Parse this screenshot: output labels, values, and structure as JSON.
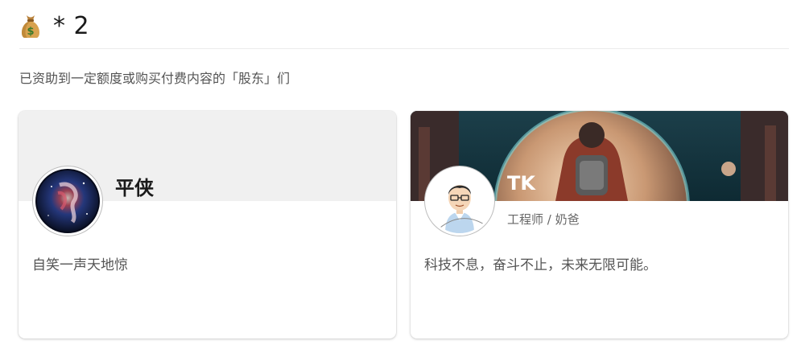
{
  "header": {
    "icon": "money-bag-icon",
    "count_text": "* 2"
  },
  "subtitle": "已资助到一定额度或购买付费内容的「股东」们",
  "cards": [
    {
      "name": "平侠",
      "role": "",
      "bio": "自笑一声天地惊",
      "banner": "plain-gray",
      "avatar": "galaxy-avatar"
    },
    {
      "name": "TK",
      "role": "工程师 / 奶爸",
      "bio": "科技不息，奋斗不止，未来无限可能。",
      "banner": "astronaut-planet-art",
      "avatar": "cartoon-man-avatar"
    }
  ],
  "colors": {
    "card_shadow": "#d0d0d0",
    "banner_gray": "#f0f0f0",
    "text_muted": "#555555"
  }
}
